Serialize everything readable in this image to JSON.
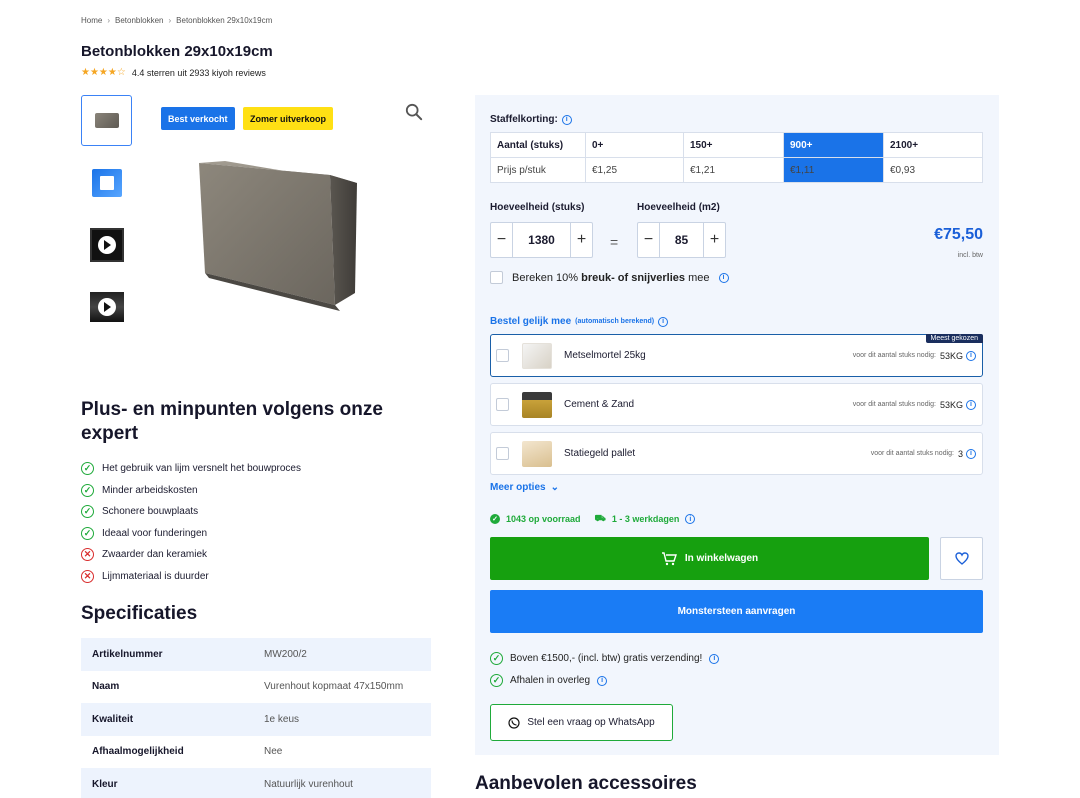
{
  "breadcrumb": [
    "Home",
    "Betonblokken",
    "Betonblokken 29x10x19cm"
  ],
  "product": {
    "title": "Betonblokken 29x10x19cm",
    "stars": "★★★★☆",
    "rating_text": "4.4 sterren uit 2933 kiyoh reviews",
    "badge_best": "Best verkocht",
    "badge_sale": "Zomer uitverkoop"
  },
  "thumbnails": [
    "product-block",
    "3d-cube",
    "video",
    "video"
  ],
  "pros": {
    "title": "Plus- en minpunten volgens onze expert",
    "items": [
      {
        "type": "plus",
        "text": "Het gebruik van lijm versnelt het bouwproces"
      },
      {
        "type": "plus",
        "text": "Minder arbeidskosten"
      },
      {
        "type": "plus",
        "text": "Schonere bouwplaats"
      },
      {
        "type": "plus",
        "text": "Ideaal voor funderingen"
      },
      {
        "type": "min",
        "text": "Zwaarder dan keramiek"
      },
      {
        "type": "min",
        "text": "Lijmmateriaal is duurder"
      }
    ]
  },
  "specs": {
    "title": "Specificaties",
    "rows": [
      [
        "Artikelnummer",
        "MW200/2"
      ],
      [
        "Naam",
        "Vurenhout kopmaat 47x150mm"
      ],
      [
        "Kwaliteit",
        "1e keus"
      ],
      [
        "Afhaalmogelijkheid",
        "Nee"
      ],
      [
        "Kleur",
        "Natuurlijk vurenhout"
      ]
    ]
  },
  "staffel": {
    "label": "Staffelkorting:",
    "header": [
      "Aantal (stuks)",
      "0+",
      "150+",
      "900+",
      "2100+"
    ],
    "prices": [
      "Prijs p/stuk",
      "€1,25",
      "€1,21",
      "€1,11",
      "€0,93"
    ],
    "selected_index": 3
  },
  "quantity": {
    "stuks_label": "Hoeveelheid (stuks)",
    "stuks_value": "1380",
    "m2_label": "Hoeveelheid (m2)",
    "m2_value": "85",
    "minus": "−",
    "plus": "+",
    "equals": "=",
    "total": "€75,50",
    "incl": "incl. btw"
  },
  "breuk": {
    "pre": "Bereken 10% ",
    "bold": "breuk- of snijverlies",
    "post": " mee"
  },
  "bestel": {
    "label": "Bestel gelijk mee",
    "sub": "(automatisch berekend)",
    "meest": "Meest gekozen",
    "items": [
      {
        "name": "Metselmortel 25kg",
        "note": "voor dit aantal stuks nodig:",
        "qty": "53KG"
      },
      {
        "name": "Cement & Zand",
        "note": "voor dit aantal stuks nodig:",
        "qty": "53KG"
      },
      {
        "name": "Statiegeld pallet",
        "note": "voor dit aantal stuks nodig:",
        "qty": "3"
      }
    ]
  },
  "meer_opties": "Meer opties",
  "stock": {
    "voorraad": "1043 op voorraad",
    "levering": "1 - 3 werkdagen"
  },
  "buttons": {
    "cart": "In winkelwagen",
    "sample": "Monstersteen aanvragen",
    "whatsapp": "Stel een vraag op WhatsApp"
  },
  "benefits": [
    "Boven €1500,- (incl. btw) gratis verzending!",
    "Afhalen in overleg"
  ],
  "accessoires_title": "Aanbevolen accessoires",
  "colors": {
    "accent": "#1a73e8",
    "cart": "#16a00f",
    "sale": "#ffe014",
    "panel": "#f2f6fd"
  }
}
